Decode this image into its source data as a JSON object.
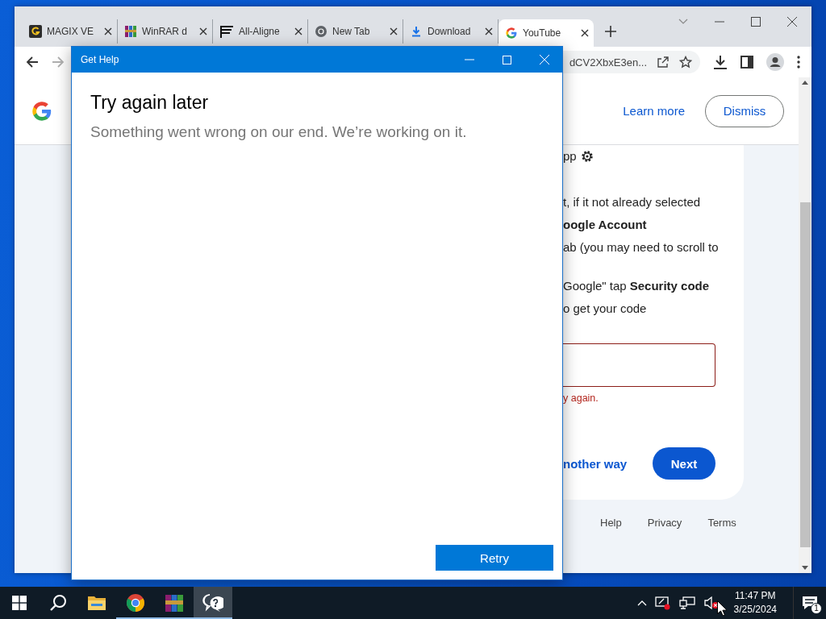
{
  "browser": {
    "tabs": [
      {
        "label": "MAGIX VE",
        "kind": "magix",
        "selected": false
      },
      {
        "label": "WinRAR d",
        "kind": "winrar",
        "selected": false
      },
      {
        "label": "All-Aligne",
        "kind": "lines",
        "selected": false
      },
      {
        "label": "New Tab",
        "kind": "chrome",
        "selected": false
      },
      {
        "label": "Download",
        "kind": "download",
        "selected": false
      },
      {
        "label": "YouTube",
        "kind": "google",
        "selected": true
      }
    ],
    "forward_disabled": true,
    "url": "dCV2XbxE3en...",
    "banner": {
      "learn_more": "Learn more",
      "dismiss": "Dismiss"
    },
    "paragraphs": [
      [
        {
          "text": "pp",
          "kind": "gear"
        }
      ],
      [
        {
          "text": "t, if it not already selected"
        },
        {
          "text": "oogle Account",
          "bold": true
        },
        {
          "text": "ab (you may need to scroll to"
        }
      ],
      [
        {
          "text": "Google\" tap **Security code**"
        },
        {
          "text": "o get your code"
        }
      ]
    ],
    "code_field": {
      "invalid": true
    },
    "error_text": "y again.",
    "other_way": "nother way",
    "next": "Next",
    "footer": [
      "Help",
      "Privacy",
      "Terms"
    ]
  },
  "dialog": {
    "title": "Get Help",
    "heading": "Try again later",
    "message": "Something went wrong on our end. We’re working on it.",
    "retry": "Retry"
  },
  "taskbar": {
    "apps": [
      {
        "kind": "start",
        "running": false,
        "active": false
      },
      {
        "kind": "search",
        "running": false,
        "active": false
      },
      {
        "kind": "explorer",
        "running": false,
        "active": false
      },
      {
        "kind": "chrome",
        "running": true,
        "active": false
      },
      {
        "kind": "winrar",
        "running": true,
        "active": false
      },
      {
        "kind": "help",
        "running": true,
        "active": true
      }
    ],
    "time": "11:47 PM",
    "date": "3/25/2024",
    "notifications": "1"
  }
}
